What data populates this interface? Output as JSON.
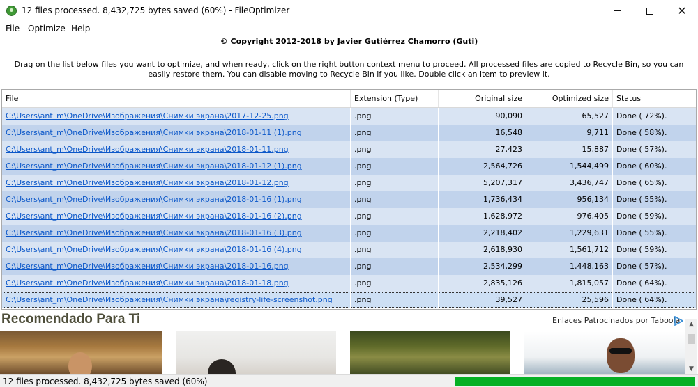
{
  "window": {
    "title": "12 files processed. 8,432,725 bytes saved (60%) - FileOptimizer",
    "buttons": [
      "minimize",
      "maximize",
      "close"
    ]
  },
  "menu": [
    {
      "label": "File"
    },
    {
      "label": "Optimize"
    },
    {
      "label": "Help"
    }
  ],
  "header": {
    "copyright": "© Copyright 2012-2018 by Javier Gutiérrez Chamorro (Guti)",
    "instructions": "Drag on the list below files you want to optimize, and when ready, click on the right button context menu to proceed. All processed files are copied to Recycle Bin, so you can easily restore them. You can disable moving to Recycle Bin if you like. Double click an item to preview it."
  },
  "table": {
    "columns": [
      "File",
      "Extension (Type)",
      "Original size",
      "Optimized size",
      "Status"
    ],
    "rows": [
      {
        "file": "C:\\Users\\ant_m\\OneDrive\\Изображения\\Снимки экрана\\2017-12-25.png",
        "ext": ".png",
        "orig": "90,090",
        "opt": "65,527",
        "status": "Done ( 72%)."
      },
      {
        "file": "C:\\Users\\ant_m\\OneDrive\\Изображения\\Снимки экрана\\2018-01-11 (1).png",
        "ext": ".png",
        "orig": "16,548",
        "opt": "9,711",
        "status": "Done ( 58%)."
      },
      {
        "file": "C:\\Users\\ant_m\\OneDrive\\Изображения\\Снимки экрана\\2018-01-11.png",
        "ext": ".png",
        "orig": "27,423",
        "opt": "15,887",
        "status": "Done ( 57%)."
      },
      {
        "file": "C:\\Users\\ant_m\\OneDrive\\Изображения\\Снимки экрана\\2018-01-12 (1).png",
        "ext": ".png",
        "orig": "2,564,726",
        "opt": "1,544,499",
        "status": "Done ( 60%)."
      },
      {
        "file": "C:\\Users\\ant_m\\OneDrive\\Изображения\\Снимки экрана\\2018-01-12.png",
        "ext": ".png",
        "orig": "5,207,317",
        "opt": "3,436,747",
        "status": "Done ( 65%)."
      },
      {
        "file": "C:\\Users\\ant_m\\OneDrive\\Изображения\\Снимки экрана\\2018-01-16 (1).png",
        "ext": ".png",
        "orig": "1,736,434",
        "opt": "956,134",
        "status": "Done ( 55%)."
      },
      {
        "file": "C:\\Users\\ant_m\\OneDrive\\Изображения\\Снимки экрана\\2018-01-16 (2).png",
        "ext": ".png",
        "orig": "1,628,972",
        "opt": "976,405",
        "status": "Done ( 59%)."
      },
      {
        "file": "C:\\Users\\ant_m\\OneDrive\\Изображения\\Снимки экрана\\2018-01-16 (3).png",
        "ext": ".png",
        "orig": "2,218,402",
        "opt": "1,229,631",
        "status": "Done ( 55%)."
      },
      {
        "file": "C:\\Users\\ant_m\\OneDrive\\Изображения\\Снимки экрана\\2018-01-16 (4).png",
        "ext": ".png",
        "orig": "2,618,930",
        "opt": "1,561,712",
        "status": "Done ( 59%)."
      },
      {
        "file": "C:\\Users\\ant_m\\OneDrive\\Изображения\\Снимки экрана\\2018-01-16.png",
        "ext": ".png",
        "orig": "2,534,299",
        "opt": "1,448,163",
        "status": "Done ( 57%)."
      },
      {
        "file": "C:\\Users\\ant_m\\OneDrive\\Изображения\\Снимки экрана\\2018-01-18.png",
        "ext": ".png",
        "orig": "2,835,126",
        "opt": "1,815,057",
        "status": "Done ( 64%)."
      },
      {
        "file": "C:\\Users\\ant_m\\OneDrive\\Изображения\\Снимки экрана\\registry-life-screenshot.png",
        "ext": ".png",
        "orig": "39,527",
        "opt": "25,596",
        "status": "Done ( 64%).",
        "selected": true
      }
    ]
  },
  "recommendations": {
    "title": "Recomendado Para Ti",
    "sponsor": "Enlaces Patrocinados por Taboola"
  },
  "statusbar": {
    "text": "12 files processed. 8,432,725 bytes saved (60%)",
    "progress": 1.0
  },
  "colors": {
    "link": "#0b57c9",
    "row_light": "#d9e4f3",
    "row_dark": "#c1d3ec",
    "progress": "#06b025"
  }
}
